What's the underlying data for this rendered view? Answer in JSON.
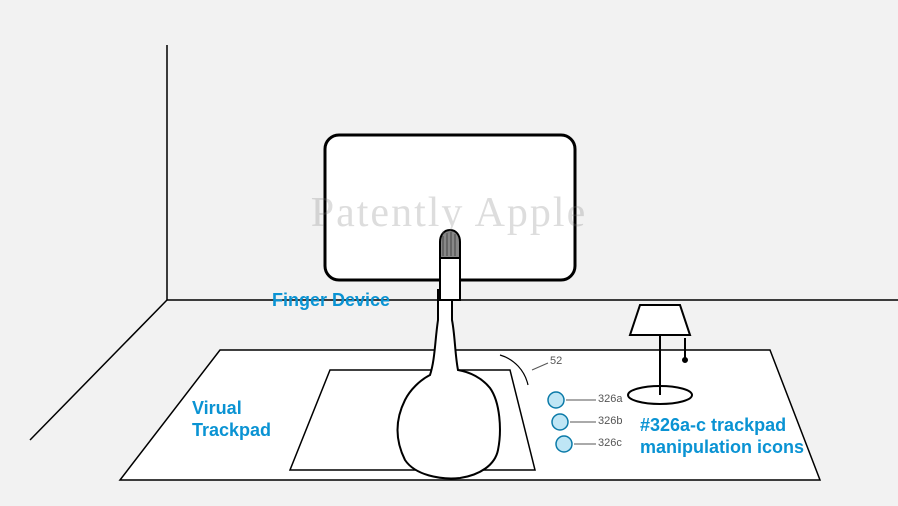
{
  "watermark": "Patently Apple",
  "labels": {
    "finger_device": "Finger Device",
    "virtual_trackpad_line1": "Virual",
    "virtual_trackpad_line2": "Trackpad",
    "icons_line1": "#326a-c trackpad",
    "icons_line2": "manipulation icons"
  },
  "refs": {
    "hand": "52",
    "icon_a": "326a",
    "icon_b": "326b",
    "icon_c": "326c"
  },
  "colors": {
    "accent": "#0a93d3",
    "line": "#000000",
    "icon_fill": "#bfe6f5"
  }
}
